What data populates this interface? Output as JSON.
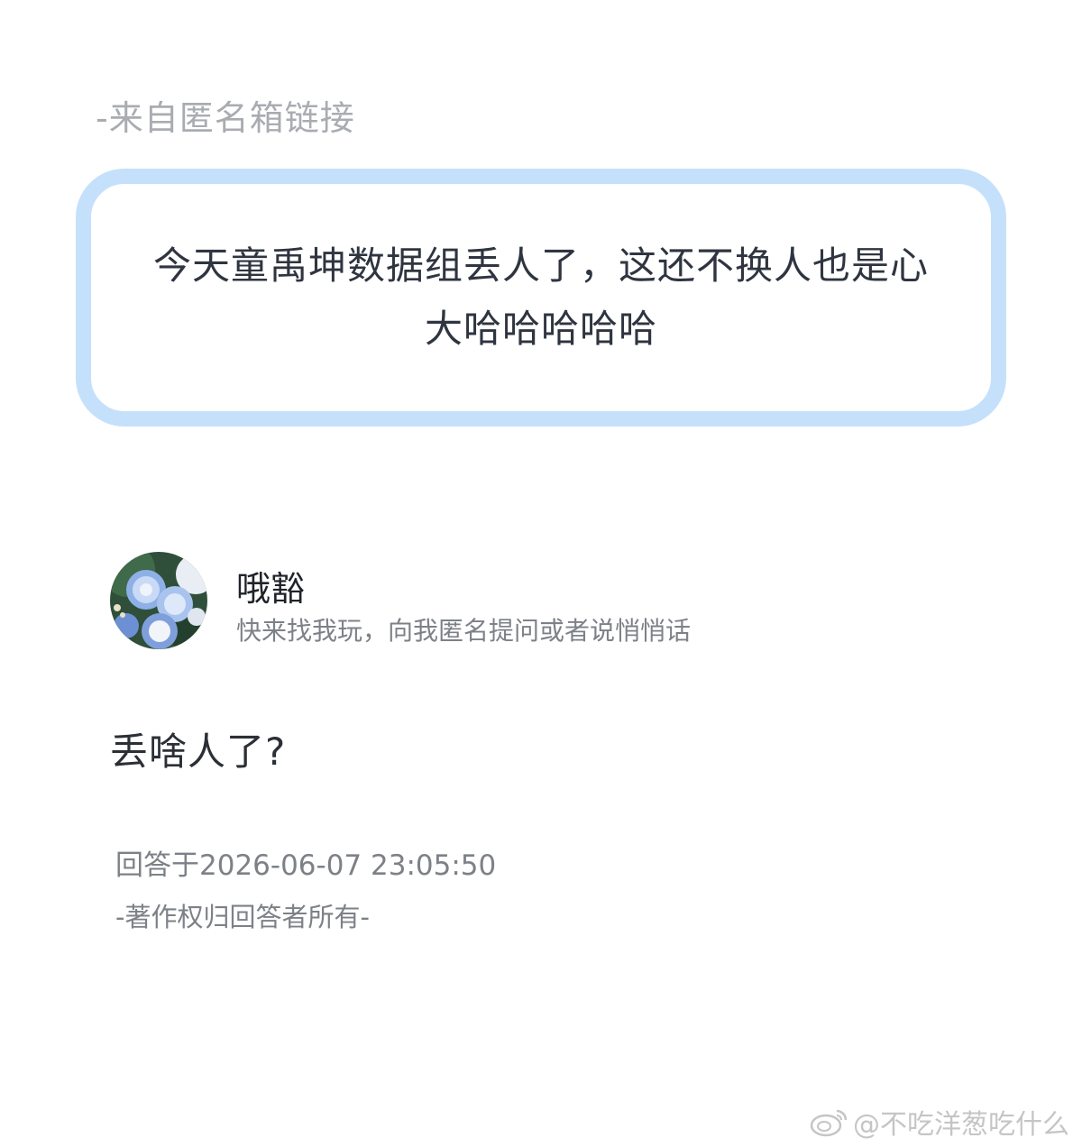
{
  "source": {
    "label": "-来自匿名箱链接"
  },
  "question": {
    "text": "今天童禹坤数据组丢人了，这还不换人也是心大哈哈哈哈哈"
  },
  "profile": {
    "nickname": "哦豁",
    "bio": "快来找我玩，向我匿名提问或者说悄悄话",
    "avatar_icon": "blue-roses-avatar"
  },
  "answer": {
    "text": "丢啥人了?"
  },
  "footer": {
    "answered_at": "回答于2026-06-07 23:05:50",
    "copyright": "-著作权归回答者所有-"
  },
  "watermark": {
    "text": "@不吃洋葱吃什么",
    "icon": "weibo-logo-icon"
  },
  "colors": {
    "card_border": "#c5e0fb",
    "muted_text": "#a9acb1",
    "secondary_text": "#7d8187"
  }
}
